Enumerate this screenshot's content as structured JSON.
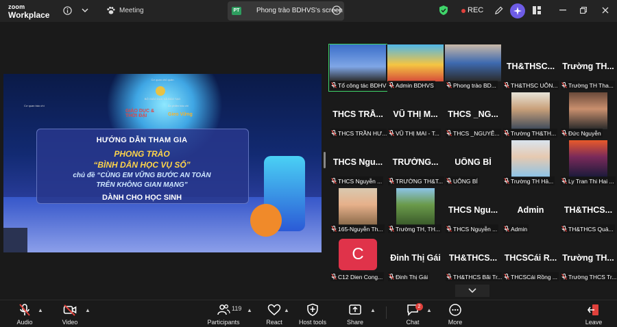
{
  "app": {
    "brand_line1": "zoom",
    "brand_line2": "Workplace"
  },
  "topbar": {
    "meeting_label": "Meeting",
    "share_initials": "PT",
    "share_title": "Phong trào BDHVS's screen",
    "rec_label": "REC",
    "colors": {
      "rec": "#e0413c",
      "secure": "#3fd56a",
      "ai": "#6e5ce6"
    }
  },
  "slide": {
    "line_agency1": "Cơ quan chủ quản",
    "line_agency2": "BỘ GIÁO DỤC VÀ ĐÀO TẠO",
    "line_org": "Cơ quan báo chí",
    "line_product": "Ấn phẩm báo chí",
    "logo1": "GIÁO DỤC & THỜI ĐẠI",
    "logo2": "Gieo Vững",
    "title1": "HƯỚNG DẪN THAM GIA",
    "title2": "PHONG TRÀO",
    "title3": "“BÌNH DÂN HỌC VỤ SỐ”",
    "title4": "chủ đề “CÙNG EM VỮNG BƯỚC AN TOÀN",
    "title5": "TRÊN KHÔNG GIAN MẠNG”",
    "title6": "DÀNH CHO HỌC SINH"
  },
  "gallery": [
    {
      "label": "Tổ công tác BDHVS",
      "video": true,
      "active": true
    },
    {
      "label": "Admin BDHVS",
      "video": true
    },
    {
      "label": "Phong trào BD...",
      "video": true
    },
    {
      "name": "TH&THSC...",
      "label": "TH&THSC UÔN..."
    },
    {
      "name": "Trường TH...",
      "label": "Trường TH Tha..."
    },
    {
      "name": "THCS TRẦ...",
      "label": "THCS TRẦN HƯ..."
    },
    {
      "name": "VŨ THỊ M...",
      "label": "VŨ THỊ MAI - T..."
    },
    {
      "name": "THCS _NG...",
      "label": "THCS _NGUYỄ..."
    },
    {
      "label": "Trường TH&TH...",
      "video": true
    },
    {
      "label": "Đức Nguyễn",
      "video": true
    },
    {
      "name": "THCS Ngu...",
      "label": "THCS Nguyễn ..."
    },
    {
      "name": "TRƯỜNG...",
      "label": "TRƯỜNG TH&T..."
    },
    {
      "name": "UÔNG BÍ",
      "label": "UÔNG BÍ"
    },
    {
      "label": "Trường TH Hả...",
      "video": true
    },
    {
      "label": "Ly Tran Thi Hai ...",
      "video": true
    },
    {
      "label": "165-Nguyễn Th...",
      "video": true
    },
    {
      "label": "Trường TH, TH...",
      "video": true
    },
    {
      "name": "THCS Ngu...",
      "label": "THCS Nguyễn ..."
    },
    {
      "name": "Admin",
      "label": "Admin"
    },
    {
      "name": "TH&THCS...",
      "label": "TH&THCS Quả..."
    },
    {
      "avatar": "C",
      "label": "C12 Dien Cong...",
      "avatar_color": "#e0334a"
    },
    {
      "name": "Đinh Thị Gái",
      "label": "Đinh Thị Gái"
    },
    {
      "name": "TH&THCS...",
      "label": "TH&THCS Bãi Tr..."
    },
    {
      "name": "THCSCái R...",
      "label": "THCSCái Rồng ..."
    },
    {
      "name": "Trường TH...",
      "label": "Trường THCS Tr..."
    }
  ],
  "toolbar": {
    "audio": "Audio",
    "video": "Video",
    "participants": "Participants",
    "participants_count": "119",
    "react": "React",
    "host_tools": "Host tools",
    "share": "Share",
    "chat": "Chat",
    "chat_badge": "2",
    "more": "More",
    "leave": "Leave"
  }
}
